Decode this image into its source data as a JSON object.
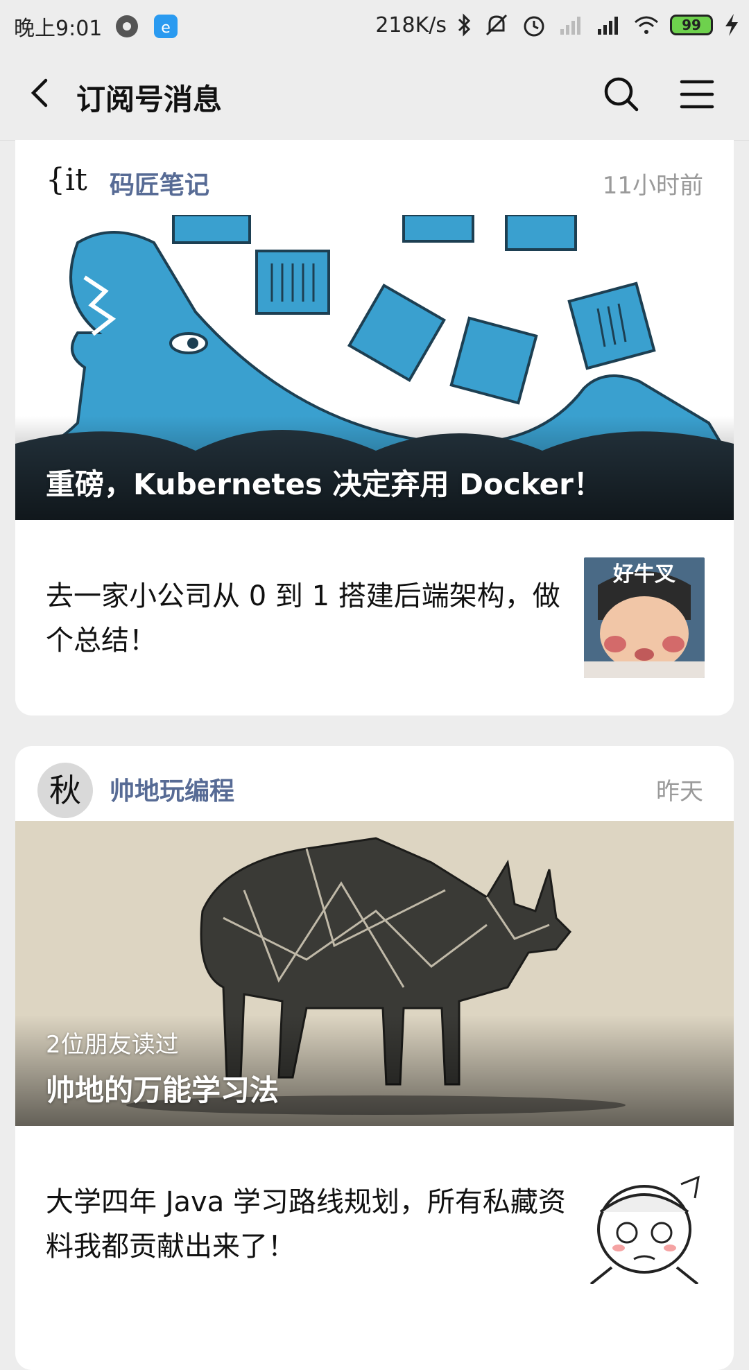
{
  "status_bar": {
    "time": "晚上9:01",
    "net_speed": "218K/s",
    "battery": "99"
  },
  "header": {
    "title": "订阅号消息"
  },
  "cards": [
    {
      "source": "码匠笔记",
      "logo_text": "{it",
      "time": "11小时前",
      "cover_title": "重磅，Kubernetes 决定弃用 Docker！",
      "cover_subtitle": "",
      "item_title": "去一家小公司从 0 到 1 搭建后端架构，做个总结！",
      "thumb_text": "好牛叉"
    },
    {
      "source": "帅地玩编程",
      "logo_text": "秋",
      "time": "昨天",
      "cover_title": "帅地的万能学习法",
      "cover_subtitle": "2位朋友读过",
      "item_title": "大学四年 Java 学习路线规划，所有私藏资料我都贡献出来了！"
    }
  ],
  "colors": {
    "background": "#ededed",
    "source_name": "#576b95",
    "battery_fill": "#6ed14d"
  }
}
